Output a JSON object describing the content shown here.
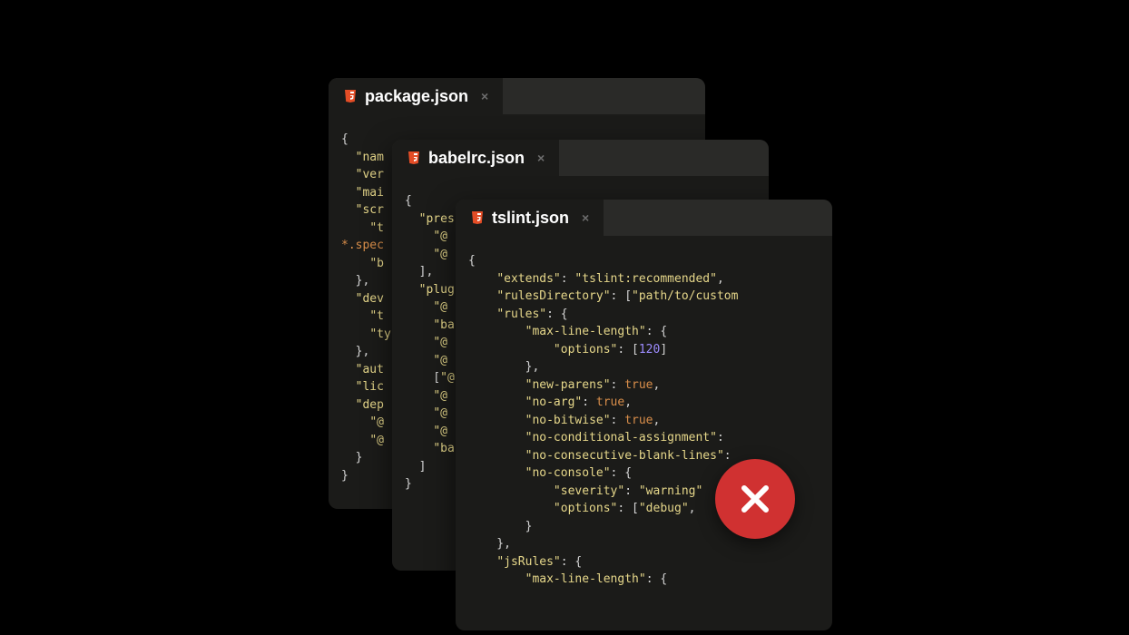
{
  "windows": {
    "package": {
      "tab_label": "package.json",
      "code_lines": [
        [
          [
            "pu",
            "{"
          ]
        ],
        [
          [
            "pu",
            "  "
          ],
          [
            "key",
            "\"nam"
          ]
        ],
        [
          [
            "pu",
            "  "
          ],
          [
            "key",
            "\"ver"
          ]
        ],
        [
          [
            "pu",
            "  "
          ],
          [
            "key",
            "\"mai"
          ]
        ],
        [
          [
            "pu",
            "  "
          ],
          [
            "key",
            "\"scr"
          ]
        ],
        [
          [
            "pu",
            "    "
          ],
          [
            "key",
            "\"t"
          ]
        ],
        [
          [
            "tag",
            "*.spec"
          ]
        ],
        [
          [
            "pu",
            "    "
          ],
          [
            "key",
            "\"b"
          ]
        ],
        [
          [
            "pu",
            "  },"
          ]
        ],
        [
          [
            "pu",
            "  "
          ],
          [
            "key",
            "\"dev"
          ]
        ],
        [
          [
            "pu",
            "    "
          ],
          [
            "key",
            "\"t"
          ]
        ],
        [
          [
            "pu",
            "    "
          ],
          [
            "key",
            "\"ty"
          ]
        ],
        [
          [
            "pu",
            "  },"
          ]
        ],
        [
          [
            "pu",
            "  "
          ],
          [
            "key",
            "\"aut"
          ]
        ],
        [
          [
            "pu",
            "  "
          ],
          [
            "key",
            "\"lic"
          ]
        ],
        [
          [
            "pu",
            "  "
          ],
          [
            "key",
            "\"dep"
          ]
        ],
        [
          [
            "pu",
            "    "
          ],
          [
            "key",
            "\"@"
          ]
        ],
        [
          [
            "pu",
            "    "
          ],
          [
            "key",
            "\"@"
          ]
        ],
        [
          [
            "pu",
            "  }"
          ]
        ],
        [
          [
            "pu",
            "}"
          ]
        ]
      ]
    },
    "babelrc": {
      "tab_label": "babelrc.json",
      "code_lines": [
        [
          [
            "pu",
            "{"
          ]
        ],
        [
          [
            "pu",
            "  "
          ],
          [
            "key",
            "\"pres"
          ]
        ],
        [
          [
            "pu",
            "    "
          ],
          [
            "key",
            "\"@"
          ]
        ],
        [
          [
            "pu",
            "    "
          ],
          [
            "key",
            "\"@"
          ]
        ],
        [
          [
            "pu",
            "  ],"
          ]
        ],
        [
          [
            "pu",
            "  "
          ],
          [
            "key",
            "\"plug"
          ]
        ],
        [
          [
            "pu",
            "    "
          ],
          [
            "key",
            "\"@"
          ]
        ],
        [
          [
            "pu",
            "    "
          ],
          [
            "key",
            "\"ba"
          ]
        ],
        [
          [
            "pu",
            "    "
          ],
          [
            "key",
            "\"@"
          ]
        ],
        [
          [
            "pu",
            "    "
          ],
          [
            "key",
            "\"@"
          ]
        ],
        [
          [
            "pu",
            "    ["
          ],
          [
            "key",
            "\"@"
          ]
        ],
        [
          [
            "pu",
            "    "
          ],
          [
            "key",
            "\"@"
          ]
        ],
        [
          [
            "pu",
            "    "
          ],
          [
            "key",
            "\"@"
          ]
        ],
        [
          [
            "pu",
            "    "
          ],
          [
            "key",
            "\"@"
          ]
        ],
        [
          [
            "pu",
            "    "
          ],
          [
            "key",
            "\"ba"
          ]
        ],
        [
          [
            "pu",
            "  ]"
          ]
        ],
        [
          [
            "pu",
            "}"
          ]
        ]
      ]
    },
    "tslint": {
      "tab_label": "tslint.json",
      "code_lines": [
        [
          [
            "pu",
            "{"
          ]
        ],
        [
          [
            "pu",
            "    "
          ],
          [
            "key",
            "\"extends\""
          ],
          [
            "pu",
            ": "
          ],
          [
            "key",
            "\"tslint:recommended\""
          ],
          [
            "pu",
            ","
          ]
        ],
        [
          [
            "pu",
            "    "
          ],
          [
            "key",
            "\"rulesDirectory\""
          ],
          [
            "pu",
            ": ["
          ],
          [
            "key",
            "\"path/to/custom"
          ]
        ],
        [
          [
            "pu",
            "    "
          ],
          [
            "key",
            "\"rules\""
          ],
          [
            "pu",
            ": {"
          ]
        ],
        [
          [
            "pu",
            "        "
          ],
          [
            "key",
            "\"max-line-length\""
          ],
          [
            "pu",
            ": {"
          ]
        ],
        [
          [
            "pu",
            "            "
          ],
          [
            "key",
            "\"options\""
          ],
          [
            "pu",
            ": ["
          ],
          [
            "num",
            "120"
          ],
          [
            "pu",
            "]"
          ]
        ],
        [
          [
            "pu",
            "        },"
          ]
        ],
        [
          [
            "pu",
            "        "
          ],
          [
            "key",
            "\"new-parens\""
          ],
          [
            "pu",
            ": "
          ],
          [
            "boo",
            "true"
          ],
          [
            "pu",
            ","
          ]
        ],
        [
          [
            "pu",
            "        "
          ],
          [
            "key",
            "\"no-arg\""
          ],
          [
            "pu",
            ": "
          ],
          [
            "boo",
            "true"
          ],
          [
            "pu",
            ","
          ]
        ],
        [
          [
            "pu",
            "        "
          ],
          [
            "key",
            "\"no-bitwise\""
          ],
          [
            "pu",
            ": "
          ],
          [
            "boo",
            "true"
          ],
          [
            "pu",
            ","
          ]
        ],
        [
          [
            "pu",
            "        "
          ],
          [
            "key",
            "\"no-conditional-assignment\""
          ],
          [
            "pu",
            ": "
          ]
        ],
        [
          [
            "pu",
            "        "
          ],
          [
            "key",
            "\"no-consecutive-blank-lines\""
          ],
          [
            "pu",
            ":"
          ]
        ],
        [
          [
            "pu",
            "        "
          ],
          [
            "key",
            "\"no-console\""
          ],
          [
            "pu",
            ": {"
          ]
        ],
        [
          [
            "pu",
            "            "
          ],
          [
            "key",
            "\"severity\""
          ],
          [
            "pu",
            ": "
          ],
          [
            "key",
            "\"warning\""
          ]
        ],
        [
          [
            "pu",
            "            "
          ],
          [
            "key",
            "\"options\""
          ],
          [
            "pu",
            ": ["
          ],
          [
            "key",
            "\"debug\""
          ],
          [
            "pu",
            ","
          ]
        ],
        [
          [
            "pu",
            "        }"
          ]
        ],
        [
          [
            "pu",
            "    },"
          ]
        ],
        [
          [
            "pu",
            "    "
          ],
          [
            "key",
            "\"jsRules\""
          ],
          [
            "pu",
            ": {"
          ]
        ],
        [
          [
            "pu",
            "        "
          ],
          [
            "key",
            "\"max-line-length\""
          ],
          [
            "pu",
            ": {"
          ]
        ]
      ]
    }
  },
  "error_badge": {
    "icon": "close-x"
  }
}
